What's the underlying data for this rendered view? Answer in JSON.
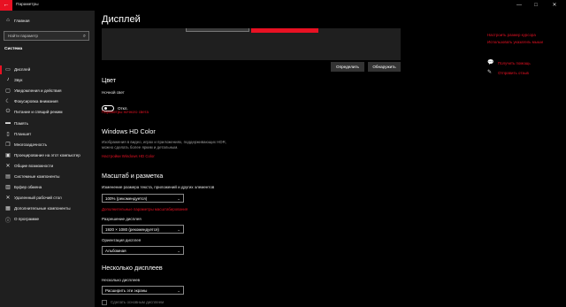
{
  "titlebar": {
    "back_glyph": "←",
    "title": "Параметры",
    "minimize": "—",
    "maximize": "□",
    "close": "✕"
  },
  "sidebar": {
    "home_label": "Главная",
    "search_placeholder": "Найти параметр",
    "section": "Система",
    "items": [
      {
        "label": "Дисплей",
        "icon": "display-icon",
        "glyph": "▭",
        "active": true
      },
      {
        "label": "Звук",
        "icon": "speaker-icon",
        "glyph": "♪",
        "active": false
      },
      {
        "label": "Уведомления и действия",
        "icon": "notification-icon",
        "glyph": "▢",
        "active": false
      },
      {
        "label": "Фокусировка внимания",
        "icon": "moon-icon",
        "glyph": "☾",
        "active": false
      },
      {
        "label": "Питание и спящий режим",
        "icon": "power-icon",
        "glyph": "⏻",
        "active": false
      },
      {
        "label": "Память",
        "icon": "storage-icon",
        "glyph": "▬",
        "active": false
      },
      {
        "label": "Планшет",
        "icon": "tablet-icon",
        "glyph": "▯",
        "active": false
      },
      {
        "label": "Многозадачность",
        "icon": "multitasking-icon",
        "glyph": "❐",
        "active": false
      },
      {
        "label": "Проецирование на этот компьютер",
        "icon": "projector-icon",
        "glyph": "▣",
        "active": false
      },
      {
        "label": "Общие возможности",
        "icon": "shared-icon",
        "glyph": "✕",
        "active": false
      },
      {
        "label": "Системные компоненты",
        "icon": "components-icon",
        "glyph": "▤",
        "active": false
      },
      {
        "label": "Буфер обмена",
        "icon": "clipboard-icon",
        "glyph": "▥",
        "active": false
      },
      {
        "label": "Удаленный рабочий стол",
        "icon": "remote-desktop-icon",
        "glyph": "✕",
        "active": false
      },
      {
        "label": "Дополнительные компоненты",
        "icon": "optional-features-icon",
        "glyph": "▦",
        "active": false
      },
      {
        "label": "О программе",
        "icon": "info-icon",
        "glyph": "ⓘ",
        "active": false
      }
    ]
  },
  "main": {
    "title": "Дисплей",
    "detect_button": "Определить",
    "identify_button": "Обнаружить",
    "color": {
      "heading": "Цвет",
      "night_light_label": "Ночной свет",
      "night_light_state": "Откл.",
      "night_light_link": "Параметры ночного света"
    },
    "hdr": {
      "heading": "Windows HD Color",
      "description": "Изображения в видео, играх и приложениях, поддерживающих HDR, можно сделать более ярким и детальным.",
      "link": "Настройки Windows HD Color"
    },
    "scale": {
      "heading": "Масштаб и разметка",
      "scale_label": "Изменение размера текста, приложений и других элементов",
      "scale_value": "100% (рекомендуется)",
      "advanced_link": "Дополнительные параметры масштабирования",
      "resolution_label": "Разрешение дисплея",
      "resolution_value": "1920 × 1080 (рекомендуется)",
      "orientation_label": "Ориентация дисплея",
      "orientation_value": "Альбомная"
    },
    "multi": {
      "heading": "Несколько дисплеев",
      "label": "Несколько дисплеев",
      "value": "Расширить эти экраны",
      "checkbox_label": "Сделать основным дисплеем"
    }
  },
  "right": {
    "links": [
      "Настроить размер курсора",
      "Использовать указатель мыши"
    ],
    "help_label": "Получить помощь",
    "feedback_label": "Отправить отзыв"
  },
  "colors": {
    "accent": "#e81123",
    "sidebar_bg": "#1f1f1f",
    "main_bg": "#000000"
  }
}
